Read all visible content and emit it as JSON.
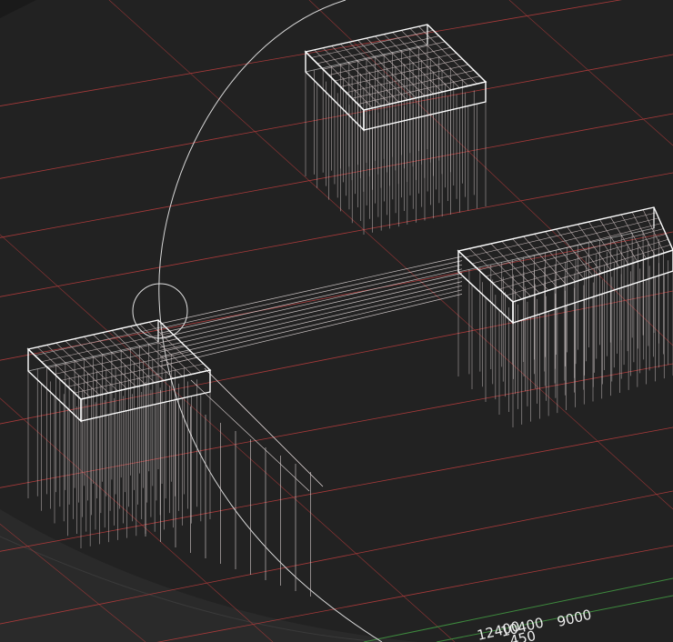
{
  "viewport": {
    "background": "#222222",
    "grid_major_color": "#a83a3a",
    "grid_axis_color": "#3e8a3e",
    "wire_color": "#ffffff",
    "pile_color": "#d8d0d0"
  },
  "dimension_labels": [
    {
      "id": "dim-12400",
      "text": "12400"
    },
    {
      "id": "dim-10400",
      "text": "10400"
    },
    {
      "id": "dim-9000",
      "text": "9000"
    },
    {
      "id": "dim-450",
      "text": "450"
    }
  ]
}
